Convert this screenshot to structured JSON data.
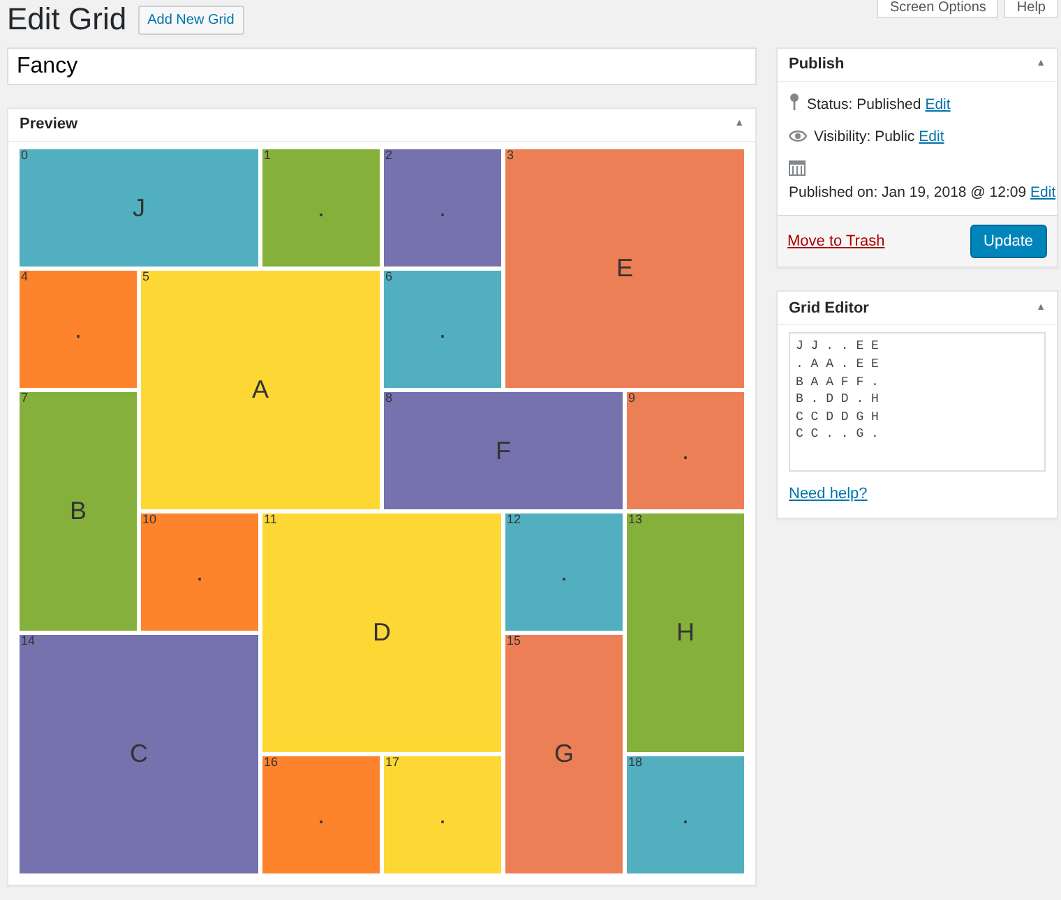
{
  "header": {
    "title": "Edit Grid",
    "add_button": "Add New Grid",
    "screen_options": "Screen Options",
    "help": "Help"
  },
  "grid_title": "Fancy",
  "preview": {
    "title": "Preview",
    "toggle": "▲",
    "items": [
      {
        "number": "0",
        "label": "J",
        "color": "#52afc0"
      },
      {
        "number": "1",
        "label": ".",
        "color": "#86b03c"
      },
      {
        "number": "2",
        "label": ".",
        "color": "#7672ae"
      },
      {
        "number": "3",
        "label": "E",
        "color": "#ec7f55"
      },
      {
        "number": "4",
        "label": ".",
        "color": "#fd842d"
      },
      {
        "number": "5",
        "label": "A",
        "color": "#fdd835"
      },
      {
        "number": "6",
        "label": ".",
        "color": "#52afc0"
      },
      {
        "number": "7",
        "label": "B",
        "color": "#86b03c"
      },
      {
        "number": "8",
        "label": "F",
        "color": "#7672ae"
      },
      {
        "number": "9",
        "label": ".",
        "color": "#ec7f55"
      },
      {
        "number": "10",
        "label": ".",
        "color": "#fd842d"
      },
      {
        "number": "11",
        "label": "D",
        "color": "#fdd835"
      },
      {
        "number": "12",
        "label": ".",
        "color": "#52afc0"
      },
      {
        "number": "13",
        "label": "H",
        "color": "#86b03c"
      },
      {
        "number": "14",
        "label": "C",
        "color": "#7672ae"
      },
      {
        "number": "15",
        "label": "G",
        "color": "#ec7f55"
      },
      {
        "number": "16",
        "label": ".",
        "color": "#fd842d"
      },
      {
        "number": "17",
        "label": ".",
        "color": "#fdd835"
      },
      {
        "number": "18",
        "label": ".",
        "color": "#52afc0"
      }
    ]
  },
  "publish": {
    "title": "Publish",
    "toggle": "▲",
    "rows": [
      {
        "kind": "pin",
        "text": "Status: Published",
        "link": "Edit"
      },
      {
        "kind": "eye",
        "text": "Visibility: Public",
        "link": "Edit"
      },
      {
        "kind": "calendar",
        "text": "Published on: Jan 19, 2018 @ 12:09",
        "link": "Edit"
      }
    ],
    "trash": "Move to Trash",
    "update": "Update"
  },
  "grid_editor": {
    "title": "Grid Editor",
    "toggle": "▲",
    "lines": [
      "J J . . E E",
      ". A A . E E",
      "B A A F F .",
      "B . D D . H",
      "C C D D G H",
      "C C . . G ."
    ],
    "help_link": "Need help?"
  }
}
